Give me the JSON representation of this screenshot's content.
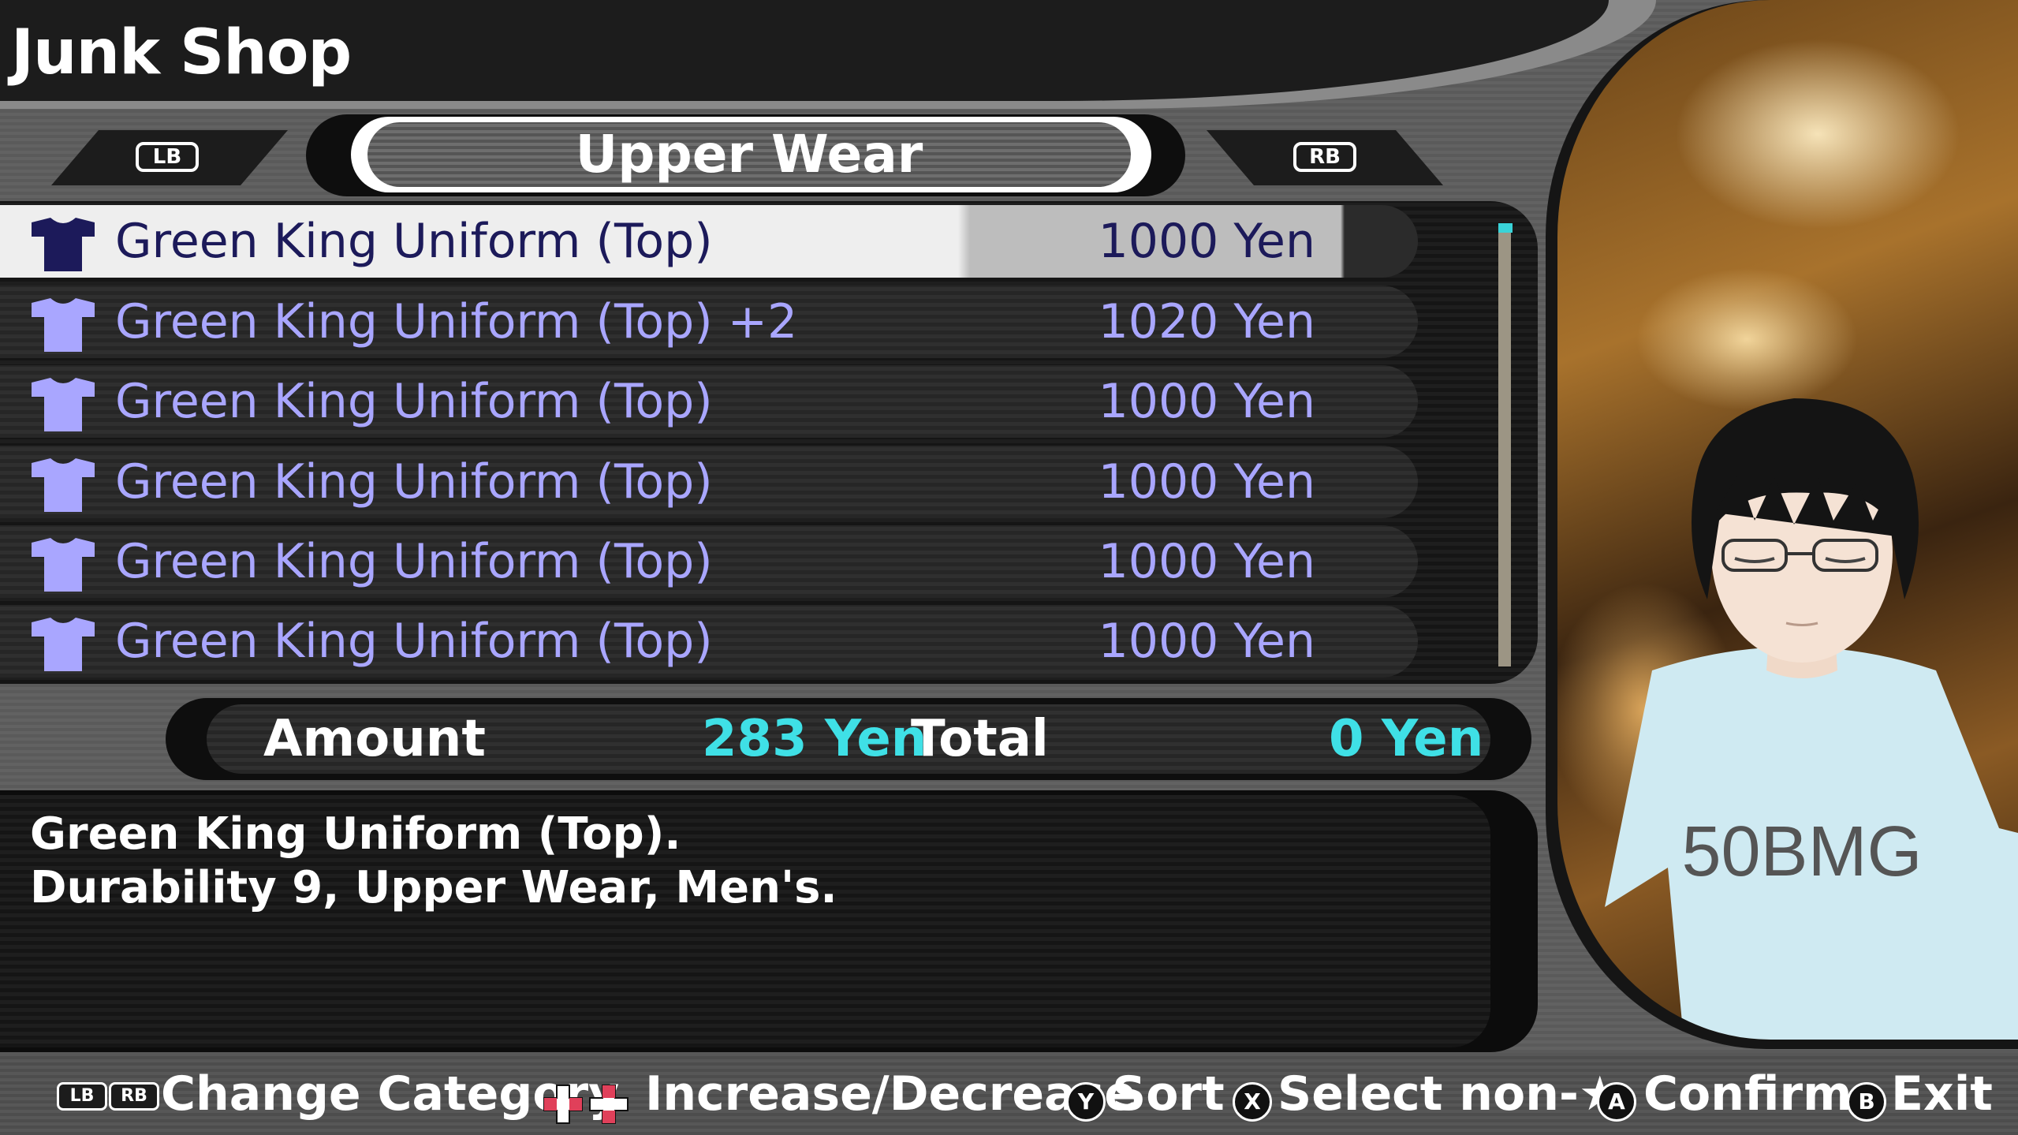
{
  "header": {
    "title": "Junk Shop"
  },
  "category": {
    "lb_label": "LB",
    "rb_label": "RB",
    "current": "Upper Wear"
  },
  "items": [
    {
      "name": "Green King Uniform (Top)",
      "price": "1000 Yen",
      "selected": true
    },
    {
      "name": "Green King Uniform (Top) +2",
      "price": "1020 Yen",
      "selected": false
    },
    {
      "name": "Green King Uniform (Top)",
      "price": "1000 Yen",
      "selected": false
    },
    {
      "name": "Green King Uniform (Top)",
      "price": "1000 Yen",
      "selected": false
    },
    {
      "name": "Green King Uniform (Top)",
      "price": "1000 Yen",
      "selected": false
    },
    {
      "name": "Green King Uniform (Top)",
      "price": "1000 Yen",
      "selected": false
    }
  ],
  "summary": {
    "amount_label": "Amount",
    "amount_value": "283 Yen",
    "total_label": "Total",
    "total_value": "0 Yen"
  },
  "description": {
    "line1": "Green King Uniform (Top).",
    "line2": "Durability 9, Upper Wear, Men's."
  },
  "portrait": {
    "shirt_text": "50BMG"
  },
  "help": {
    "lb": "LB",
    "rb": "RB",
    "change_category": "Change Category",
    "increase_decrease": "Increase/Decrease",
    "y": "Y",
    "sort": "Sort",
    "x": "X",
    "select_non": "Select non-★",
    "a": "A",
    "confirm": "Confirm",
    "b": "B",
    "exit": "Exit"
  },
  "colors": {
    "item_text": "#a9a6ff",
    "item_text_selected": "#1c1a5a",
    "accent_cyan": "#3fe0e6",
    "scroll_thumb": "#39d3d8",
    "dpad_red": "#e0405a"
  },
  "icons": {
    "item": "shirt-icon",
    "dpad": "dpad-icon"
  }
}
